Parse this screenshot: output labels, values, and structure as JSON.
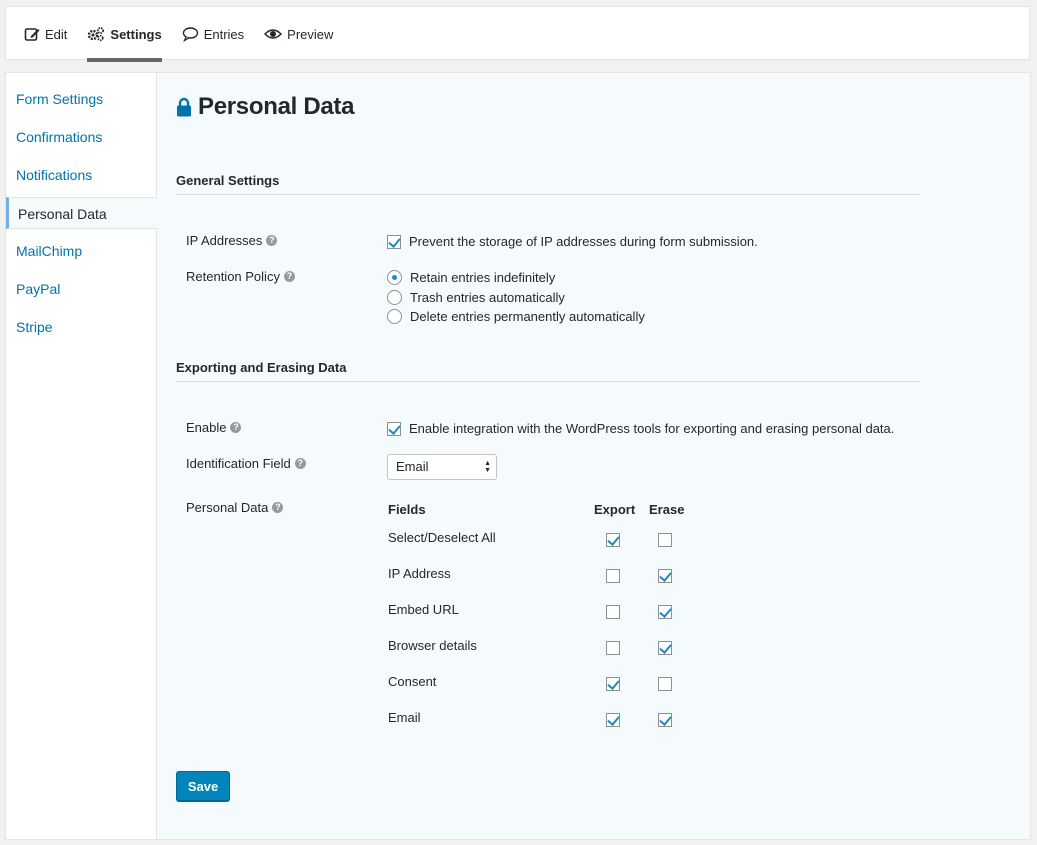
{
  "topnav": {
    "tabs": [
      {
        "label": "Edit",
        "icon": "edit-icon"
      },
      {
        "label": "Settings",
        "icon": "gear-icon",
        "active": true
      },
      {
        "label": "Entries",
        "icon": "speech-bubble-icon"
      },
      {
        "label": "Preview",
        "icon": "eye-icon"
      }
    ]
  },
  "sidebar": {
    "items": [
      {
        "label": "Form Settings"
      },
      {
        "label": "Confirmations"
      },
      {
        "label": "Notifications"
      },
      {
        "label": "Personal Data",
        "active": true
      },
      {
        "label": "MailChimp"
      },
      {
        "label": "PayPal"
      },
      {
        "label": "Stripe"
      }
    ]
  },
  "page": {
    "title": "Personal Data",
    "title_icon": "lock-icon"
  },
  "general": {
    "heading": "General Settings",
    "ip_label": "IP Addresses",
    "ip_option": "Prevent the storage of IP addresses during form submission.",
    "ip_checked": true,
    "retention_label": "Retention Policy",
    "retention_options": [
      {
        "label": "Retain entries indefinitely",
        "selected": true
      },
      {
        "label": "Trash entries automatically",
        "selected": false
      },
      {
        "label": "Delete entries permanently automatically",
        "selected": false
      }
    ]
  },
  "export": {
    "heading": "Exporting and Erasing Data",
    "enable_label": "Enable",
    "enable_option": "Enable integration with the WordPress tools for exporting and erasing personal data.",
    "enable_checked": true,
    "id_field_label": "Identification Field",
    "id_field_value": "Email",
    "personal_data_label": "Personal Data",
    "columns": {
      "fields": "Fields",
      "export": "Export",
      "erase": "Erase"
    },
    "rows": [
      {
        "field": "Select/Deselect All",
        "export": true,
        "erase": false
      },
      {
        "field": "IP Address",
        "export": false,
        "erase": true
      },
      {
        "field": "Embed URL",
        "export": false,
        "erase": true
      },
      {
        "field": "Browser details",
        "export": false,
        "erase": true
      },
      {
        "field": "Consent",
        "export": true,
        "erase": false
      },
      {
        "field": "Email",
        "export": true,
        "erase": true
      }
    ]
  },
  "actions": {
    "save_label": "Save"
  },
  "colors": {
    "accent": "#0085ba",
    "link": "#0073aa",
    "active_border": "#72aee6",
    "check": "#1e8cbe"
  }
}
